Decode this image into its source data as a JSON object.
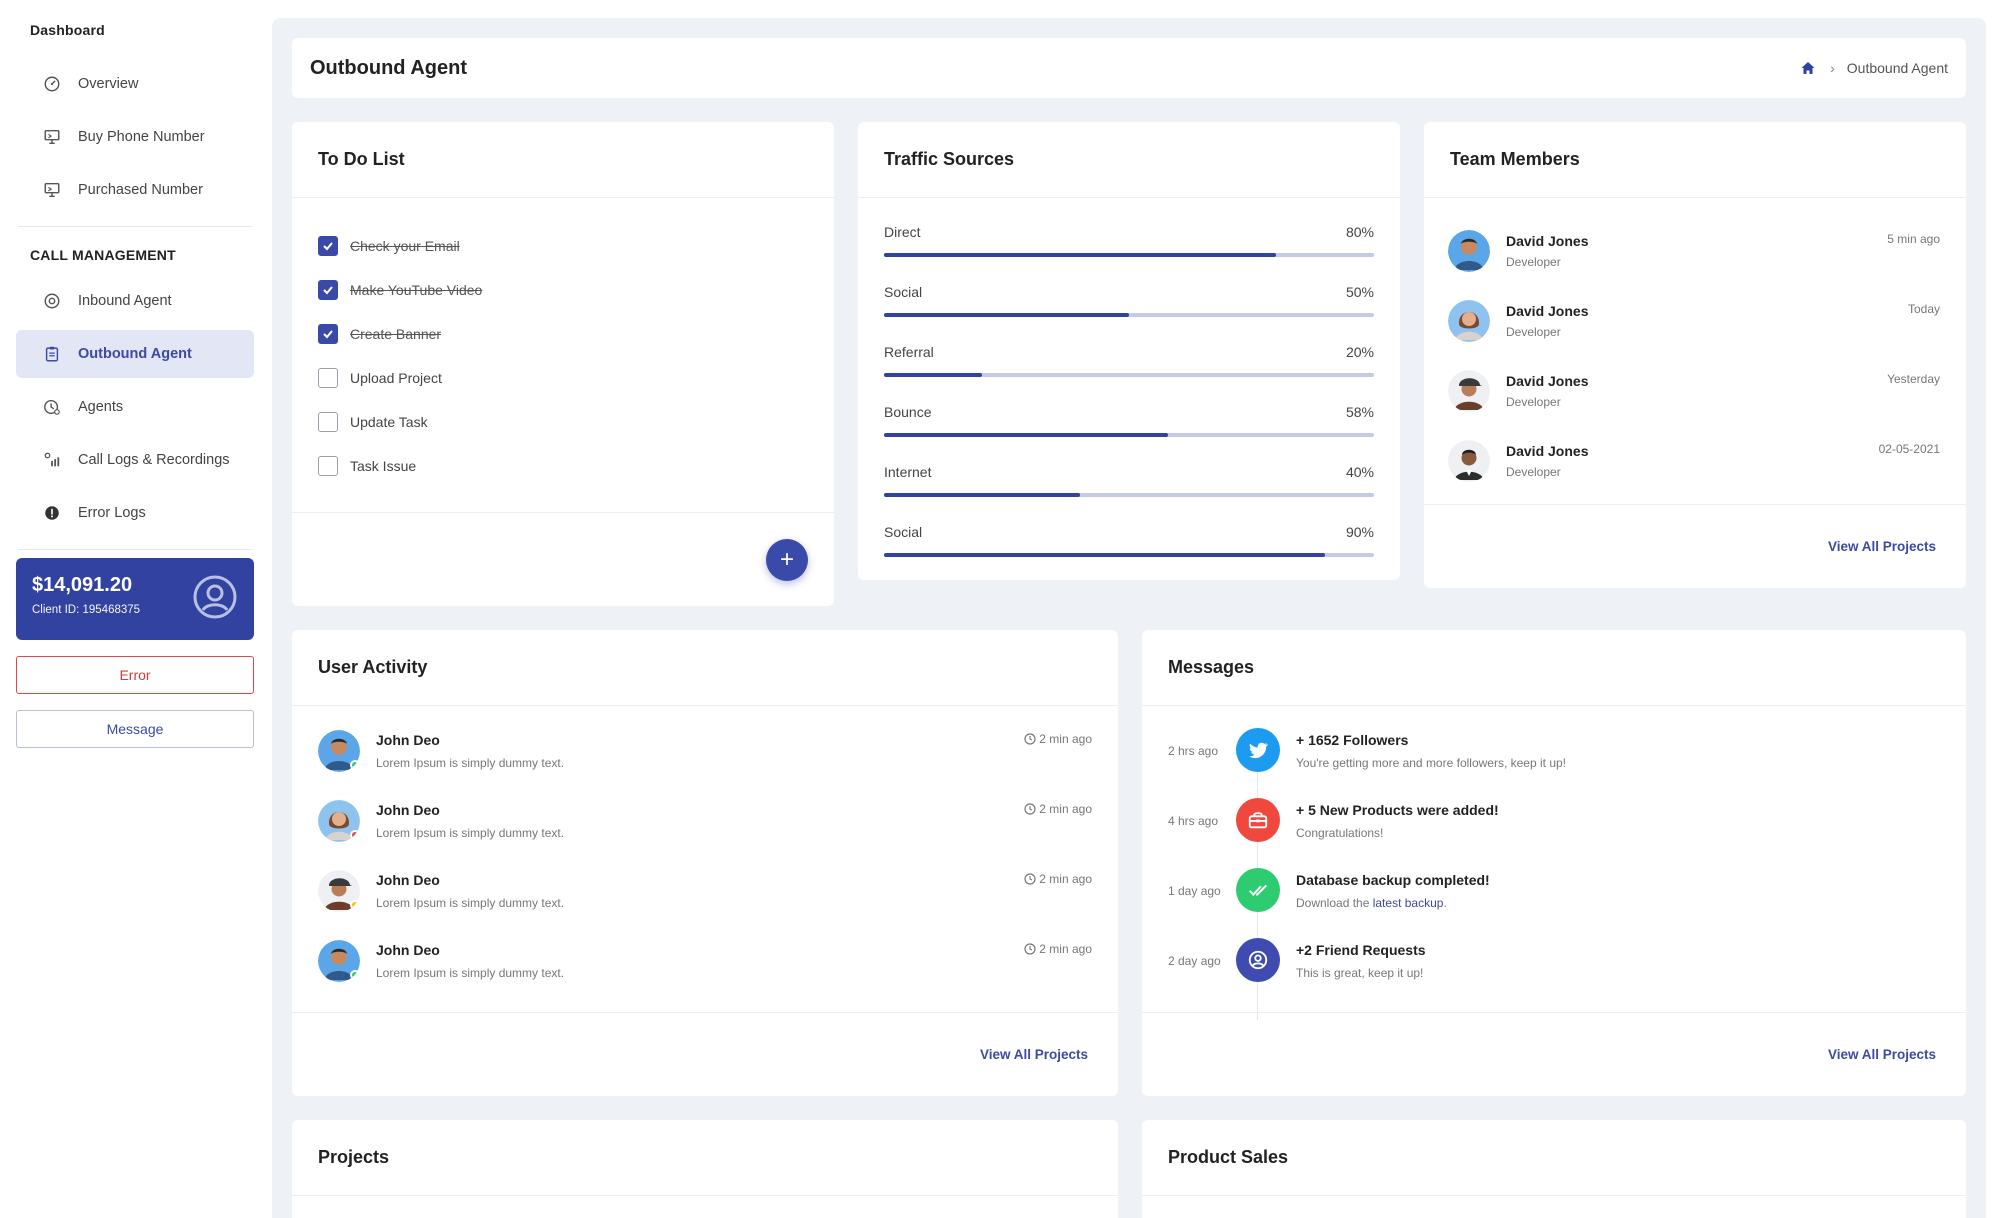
{
  "sidebar": {
    "dashboard_title": "Dashboard",
    "dashboard_items": [
      {
        "label": "Overview",
        "icon": "gauge-icon"
      },
      {
        "label": "Buy Phone Number",
        "icon": "monitor-icon"
      },
      {
        "label": "Purchased Number",
        "icon": "monitor-icon"
      }
    ],
    "call_title": "CALL MANAGEMENT",
    "call_items": [
      {
        "label": "Inbound Agent",
        "icon": "inbound-icon"
      },
      {
        "label": "Outbound Agent",
        "icon": "clipboard-icon",
        "active": true
      },
      {
        "label": "Agents",
        "icon": "clock-user-icon"
      },
      {
        "label": "Call Logs & Recordings",
        "icon": "signal-icon"
      },
      {
        "label": "Error Logs",
        "icon": "alert-circle-icon"
      }
    ],
    "balance": {
      "amount": "$14,091.20",
      "client": "Client ID: 195468375"
    },
    "error_button": "Error",
    "message_button": "Message"
  },
  "header": {
    "title": "Outbound Agent",
    "breadcrumb_current": "Outbound Agent"
  },
  "todo": {
    "title": "To Do List",
    "items": [
      {
        "label": "Check your Email",
        "done": true
      },
      {
        "label": "Make YouTube Video",
        "done": true
      },
      {
        "label": "Create Banner",
        "done": true
      },
      {
        "label": "Upload Project",
        "done": false
      },
      {
        "label": "Update Task",
        "done": false
      },
      {
        "label": "Task Issue",
        "done": false
      }
    ],
    "add_label": "+"
  },
  "traffic": {
    "title": "Traffic Sources",
    "rows": [
      {
        "label": "Direct",
        "value": 80,
        "display": "80%"
      },
      {
        "label": "Social",
        "value": 50,
        "display": "50%"
      },
      {
        "label": "Referral",
        "value": 20,
        "display": "20%"
      },
      {
        "label": "Bounce",
        "value": 58,
        "display": "58%"
      },
      {
        "label": "Internet",
        "value": 40,
        "display": "40%"
      },
      {
        "label": "Social",
        "value": 90,
        "display": "90%"
      }
    ]
  },
  "team": {
    "title": "Team Members",
    "members": [
      {
        "name": "David Jones",
        "role": "Developer",
        "time": "5 min ago"
      },
      {
        "name": "David Jones",
        "role": "Developer",
        "time": "Today"
      },
      {
        "name": "David Jones",
        "role": "Developer",
        "time": "Yesterday"
      },
      {
        "name": "David Jones",
        "role": "Developer",
        "time": "02-05-2021"
      }
    ],
    "view_all": "View All Projects"
  },
  "activity": {
    "title": "User Activity",
    "items": [
      {
        "name": "John Deo",
        "desc": "Lorem Ipsum is simply dummy text.",
        "time": "2 min ago",
        "status_color": "#2ecc71"
      },
      {
        "name": "John Deo",
        "desc": "Lorem Ipsum is simply dummy text.",
        "time": "2 min ago",
        "status_color": "#e74c3c"
      },
      {
        "name": "John Deo",
        "desc": "Lorem Ipsum is simply dummy text.",
        "time": "2 min ago",
        "status_color": "#f1c40f"
      },
      {
        "name": "John Deo",
        "desc": "Lorem Ipsum is simply dummy text.",
        "time": "2 min ago",
        "status_color": "#2ecc71"
      }
    ],
    "view_all": "View All Projects"
  },
  "messages": {
    "title": "Messages",
    "items": [
      {
        "when": "2 hrs ago",
        "title": "+ 1652 Followers",
        "desc": "You're getting more and more followers, keep it up!",
        "icon": "twitter-icon",
        "color": "#1d9bf0"
      },
      {
        "when": "4 hrs ago",
        "title": "+ 5 New Products were added!",
        "desc": "Congratulations!",
        "icon": "shop-icon",
        "color": "#f0473e"
      },
      {
        "when": "1 day ago",
        "title": "Database backup completed!",
        "desc": "Download the ",
        "link": "latest backup",
        "desc_end": ".",
        "icon": "double-check-icon",
        "color": "#2ecc71"
      },
      {
        "when": "2 day ago",
        "title": "+2 Friend Requests",
        "desc": "This is great, keep it up!",
        "icon": "user-circle-icon",
        "color": "#3f4bb0"
      }
    ],
    "view_all": "View All Projects"
  },
  "projects": {
    "title": "Projects"
  },
  "sales": {
    "title": "Product Sales"
  }
}
